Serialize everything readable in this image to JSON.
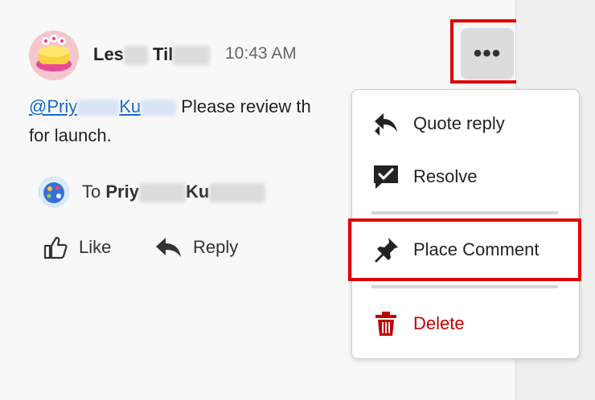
{
  "comment": {
    "author_first": "Les",
    "author_last": "Til",
    "time": "10:43 AM",
    "mention": "@Priy",
    "mention_rest": "Ku",
    "text": " Please review th",
    "text_line2": "for launch.",
    "to_label": "To",
    "to_name_first": "Priy",
    "to_name_last": "Ku"
  },
  "actions": {
    "like": "Like",
    "reply": "Reply"
  },
  "more_button": {
    "label": "•••"
  },
  "menu": {
    "items": [
      {
        "label": "Quote reply",
        "icon": "quote-reply-icon"
      },
      {
        "label": "Resolve",
        "icon": "resolve-checkbox-icon"
      },
      {
        "label": "Place Comment",
        "icon": "pin-icon"
      },
      {
        "label": "Delete",
        "icon": "trash-icon"
      }
    ]
  },
  "colors": {
    "highlight": "#e00000",
    "mention": "#1668c9",
    "delete": "#c00000"
  }
}
